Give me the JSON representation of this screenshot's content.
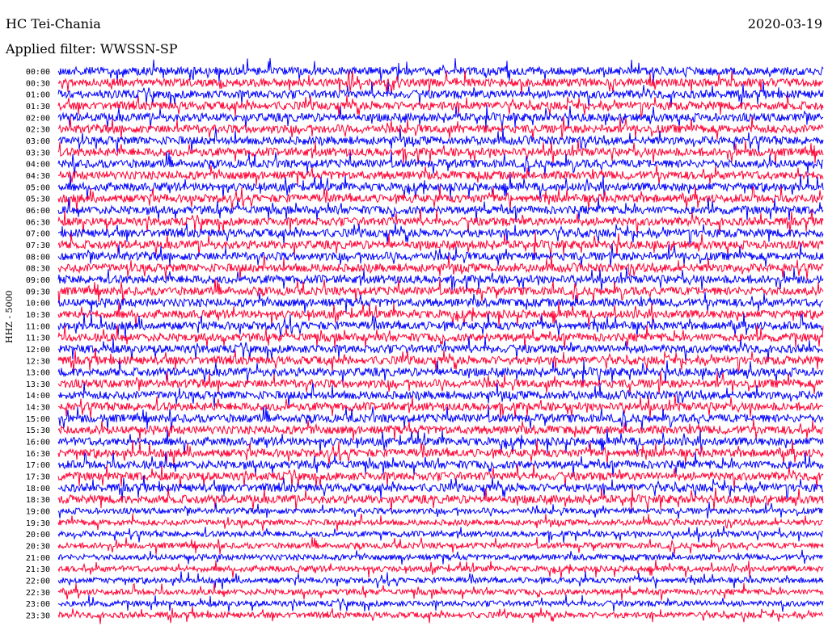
{
  "header": {
    "station": "HC Tei-Chania",
    "filter": "Applied filter: WWSSN-SP",
    "date": "2020-03-19"
  },
  "channel_label": "HHZ - 5000",
  "chart_data": {
    "type": "line",
    "title": "HC Tei-Chania",
    "subtitle": "Applied filter: WWSSN-SP",
    "date": "2020-03-19",
    "ylabel": "HHZ - 5000",
    "rows": [
      "00:00",
      "00:30",
      "01:00",
      "01:30",
      "02:00",
      "02:30",
      "03:00",
      "03:30",
      "04:00",
      "04:30",
      "05:00",
      "05:30",
      "06:00",
      "06:30",
      "07:00",
      "07:30",
      "08:00",
      "08:30",
      "09:00",
      "09:30",
      "10:00",
      "10:30",
      "11:00",
      "11:30",
      "12:00",
      "12:30",
      "13:00",
      "13:30",
      "14:00",
      "14:30",
      "15:00",
      "15:30",
      "16:00",
      "16:30",
      "17:00",
      "17:30",
      "18:00",
      "18:30",
      "19:00",
      "19:30",
      "20:00",
      "20:30",
      "21:00",
      "21:30",
      "22:00",
      "22:30",
      "23:00",
      "23:30"
    ],
    "row_colors": [
      "#0000ff",
      "#ff0033"
    ],
    "grid": false
  }
}
